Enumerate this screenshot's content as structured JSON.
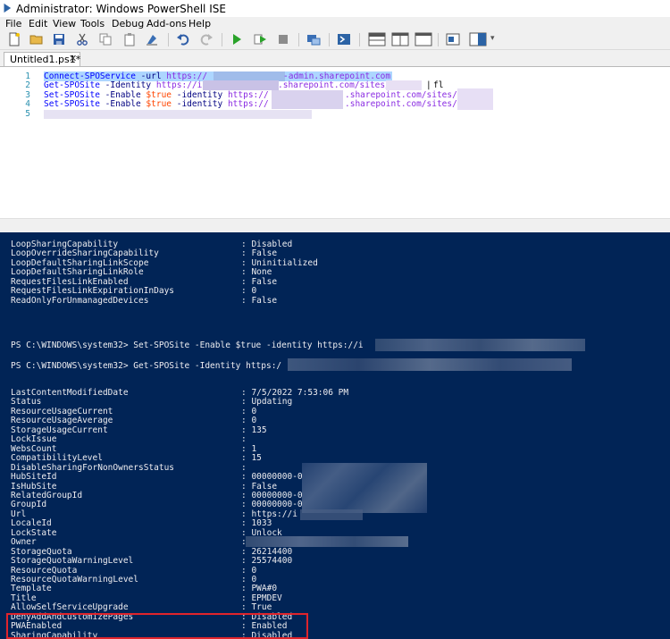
{
  "window": {
    "title": "Administrator: Windows PowerShell ISE"
  },
  "menu": [
    "File",
    "Edit",
    "View",
    "Tools",
    "Debug",
    "Add-ons",
    "Help"
  ],
  "toolbar_icons": [
    "new-file-icon",
    "open-folder-icon",
    "save-icon",
    "cut-icon",
    "copy-icon",
    "paste-icon",
    "clear-icon",
    "undo-icon",
    "redo-icon",
    "run-icon",
    "run-selection-icon",
    "stop-icon",
    "remote-tab-icon",
    "powershell-icon",
    "layout-top-icon",
    "layout-right-icon",
    "layout-max-icon",
    "show-commands-icon",
    "show-addon-icon"
  ],
  "tab": {
    "label": "Untitled1.ps1*",
    "close": "✕"
  },
  "editor": {
    "line_numbers": [
      "1",
      "2",
      "3",
      "4",
      "5"
    ],
    "line1": {
      "cmd": "Connect-SPOService",
      "param": " -url ",
      "url": "https://",
      "url_tail": "-admin.sharepoint.com"
    },
    "line2": {
      "cmd": "Get-SPOSite",
      "param": " -Identity ",
      "url": "https://i",
      "url_tail": ".sharepoint.com/sites/",
      "pipe": "|",
      "fl": "fl"
    },
    "line3": {
      "cmd": "Set-SPOSite",
      "param1": " -Enable ",
      "var": "$true",
      "param2": " -identity ",
      "url": "https://",
      "url_tail": ".sharepoint.com/sites/"
    },
    "line4": {
      "cmd": "Set-SPOSite",
      "param1": " -Enable ",
      "var": "$true",
      "param2": " -identity ",
      "url": "https://",
      "url_tail": ".sharepoint.com/sites/"
    }
  },
  "console": {
    "top_props": [
      {
        "key": "LoopSharingCapability",
        "value": ": Disabled"
      },
      {
        "key": "LoopOverrideSharingCapability",
        "value": ": False"
      },
      {
        "key": "LoopDefaultSharingLinkScope",
        "value": ": Uninitialized"
      },
      {
        "key": "LoopDefaultSharingLinkRole",
        "value": ": None"
      },
      {
        "key": "RequestFilesLinkEnabled",
        "value": ": False"
      },
      {
        "key": "RequestFilesLinkExpirationInDays",
        "value": ": 0"
      },
      {
        "key": "ReadOnlyForUnmanagedDevices",
        "value": ": False"
      }
    ],
    "prompt1": "PS C:\\WINDOWS\\system32> Set-SPOSite -Enable $true -identity https://i",
    "prompt2": "PS C:\\WINDOWS\\system32> Get-SPOSite -Identity https:/",
    "props": [
      {
        "key": "LastContentModifiedDate",
        "value": ": 7/5/2022 7:53:06 PM"
      },
      {
        "key": "Status",
        "value": ": Updating"
      },
      {
        "key": "ResourceUsageCurrent",
        "value": ": 0"
      },
      {
        "key": "ResourceUsageAverage",
        "value": ": 0"
      },
      {
        "key": "StorageUsageCurrent",
        "value": ": 135"
      },
      {
        "key": "LockIssue",
        "value": ":"
      },
      {
        "key": "WebsCount",
        "value": ": 1"
      },
      {
        "key": "CompatibilityLevel",
        "value": ": 15"
      },
      {
        "key": "DisableSharingForNonOwnersStatus",
        "value": ":"
      },
      {
        "key": "HubSiteId",
        "value": ": 00000000-0"
      },
      {
        "key": "IsHubSite",
        "value": ": False"
      },
      {
        "key": "RelatedGroupId",
        "value": ": 00000000-0"
      },
      {
        "key": "GroupId",
        "value": ": 00000000-0"
      },
      {
        "key": "Url",
        "value": ": https://i"
      },
      {
        "key": "LocaleId",
        "value": ": 1033"
      },
      {
        "key": "LockState",
        "value": ": Unlock"
      },
      {
        "key": "Owner",
        "value": ":"
      },
      {
        "key": "StorageQuota",
        "value": ": 26214400"
      },
      {
        "key": "StorageQuotaWarningLevel",
        "value": ": 25574400"
      },
      {
        "key": "ResourceQuota",
        "value": ": 0"
      },
      {
        "key": "ResourceQuotaWarningLevel",
        "value": ": 0"
      },
      {
        "key": "Template",
        "value": ": PWA#0"
      },
      {
        "key": "Title",
        "value": ": EPMDEV"
      },
      {
        "key": "AllowSelfServiceUpgrade",
        "value": ": True"
      },
      {
        "key": "DenyAddAndCustomizePages",
        "value": ": Disabled"
      },
      {
        "key": "PWAEnabled",
        "value": ": Enabled"
      },
      {
        "key": "SharingCapability",
        "value": ": Disabled"
      }
    ]
  },
  "colors": {
    "console_bg": "#012456",
    "console_fg": "#eeedf0",
    "highlight_box": "#e0242b"
  }
}
